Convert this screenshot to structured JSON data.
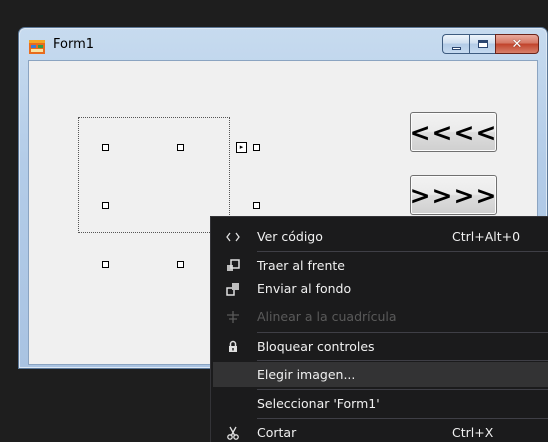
{
  "window": {
    "title": "Form1"
  },
  "form": {
    "prev_button_label": "<<<<",
    "next_button_label": ">>>>"
  },
  "context_menu": {
    "items": [
      {
        "label": "Ver código",
        "shortcut": "Ctrl+Alt+0",
        "icon": "code-icon"
      },
      {
        "label": "Traer al frente",
        "shortcut": "",
        "icon": "bring-to-front-icon"
      },
      {
        "label": "Enviar al fondo",
        "shortcut": "",
        "icon": "send-to-back-icon"
      },
      {
        "label": "Alinear a la cuadrícula",
        "shortcut": "",
        "icon": "align-to-grid-icon",
        "disabled": true
      },
      {
        "label": "Bloquear controles",
        "shortcut": "",
        "icon": "lock-icon"
      },
      {
        "label": "Elegir imagen...",
        "shortcut": "",
        "icon": ""
      },
      {
        "label": "Seleccionar 'Form1'",
        "shortcut": "",
        "icon": ""
      },
      {
        "label": "Cortar",
        "shortcut": "Ctrl+X",
        "icon": "scissors-icon"
      }
    ]
  },
  "colors": {
    "menu_background": "#1b1b1c",
    "menu_highlight": "#333334",
    "menu_text": "#f1f1f1",
    "menu_disabled_text": "#5a5a5a",
    "form_background": "#f0f0f0"
  }
}
